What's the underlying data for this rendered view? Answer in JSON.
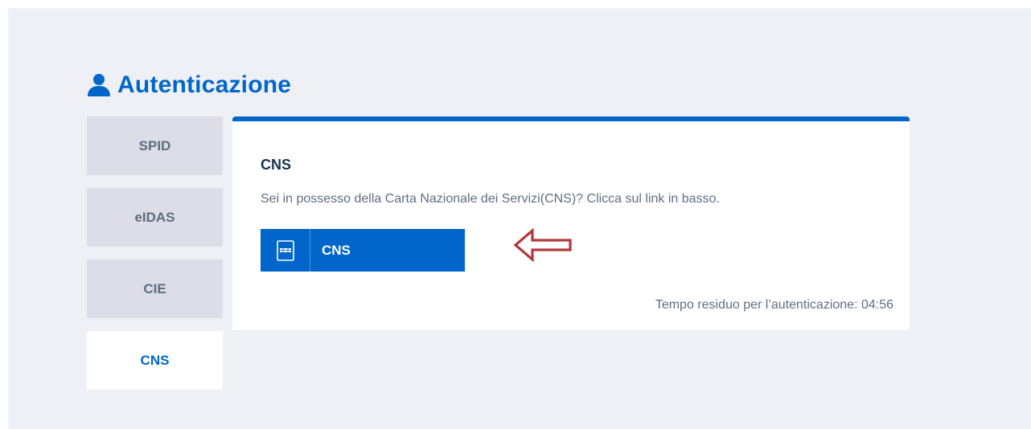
{
  "header": {
    "title": "Autenticazione",
    "icon": "user-icon"
  },
  "tabs": [
    {
      "label": "SPID",
      "active": false
    },
    {
      "label": "eIDAS",
      "active": false
    },
    {
      "label": "CIE",
      "active": false
    },
    {
      "label": "CNS",
      "active": true
    }
  ],
  "panel": {
    "title": "CNS",
    "description": "Sei in possesso della Carta Nazionale dei Servizi(CNS)? Clicca sul link in basso.",
    "button_label": "CNS",
    "button_icon": "smart-card-icon",
    "timer_text": "Tempo residuo per l’autenticazione: 04:56"
  },
  "annotation": {
    "icon": "left-arrow-icon",
    "color": "#b03a3a"
  },
  "colors": {
    "accent": "#0066cc",
    "background": "#eff0f5",
    "tab_inactive": "#dcdde6",
    "text_muted": "#5c6f82",
    "text_dark": "#17324d"
  }
}
